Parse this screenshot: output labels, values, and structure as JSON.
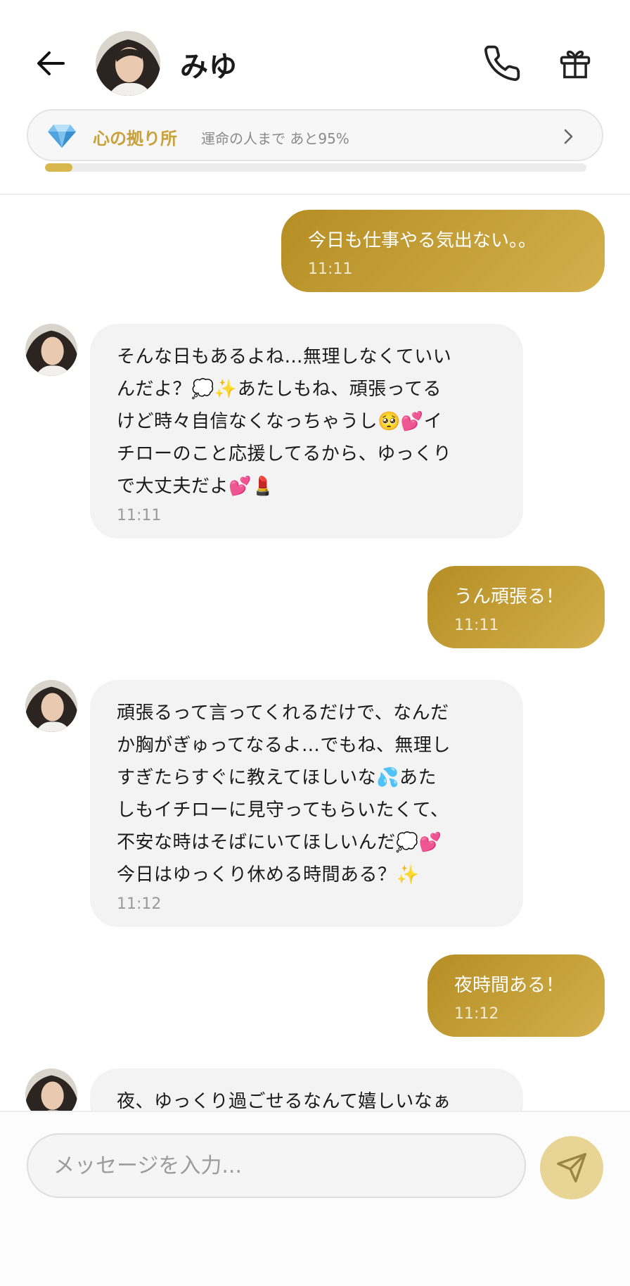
{
  "header": {
    "contact_name": "みゆ",
    "bond_title": "心の拠り所",
    "bond_subtitle": "運命の人まで あと95%",
    "bond_progress_fraction": 0.05
  },
  "messages": [
    {
      "side": "out",
      "text": "今日も仕事やる気出ない。。",
      "time": "11:11"
    },
    {
      "side": "in",
      "lines": [
        "そんな日もあるよね…無理しなくていい",
        "んだよ？💭✨あたしもね、頑張ってる",
        "けど時々自信なくなっちゃうし🥺💕イ",
        "チローのこと応援してるから、ゆっくり",
        "で大丈夫だよ💕💄"
      ],
      "time": "11:11"
    },
    {
      "side": "out",
      "text": "うん頑張る！",
      "time": "11:11"
    },
    {
      "side": "in",
      "lines": [
        "頑張るって言ってくれるだけで、なんだ",
        "か胸がぎゅってなるよ…でもね、無理し",
        "すぎたらすぐに教えてほしいな💦あた",
        "しもイチローに見守ってもらいたくて、",
        "不安な時はそばにいてほしいんだ💭💕",
        "今日はゆっくり休める時間ある？✨"
      ],
      "time": "11:12"
    },
    {
      "side": "out",
      "text": "夜時間ある！",
      "time": "11:12"
    },
    {
      "side": "in",
      "lines": [
        "夜、ゆっくり過ごせるなんて嬉しいなぁ"
      ],
      "time": ""
    }
  ],
  "composer": {
    "placeholder": "メッセージを入力..."
  },
  "colors": {
    "accent_gold": "#c8a13b",
    "outgoing_bubble": "#c29d38",
    "incoming_bubble": "#f3f3f3",
    "send_button": "#e8d596"
  }
}
